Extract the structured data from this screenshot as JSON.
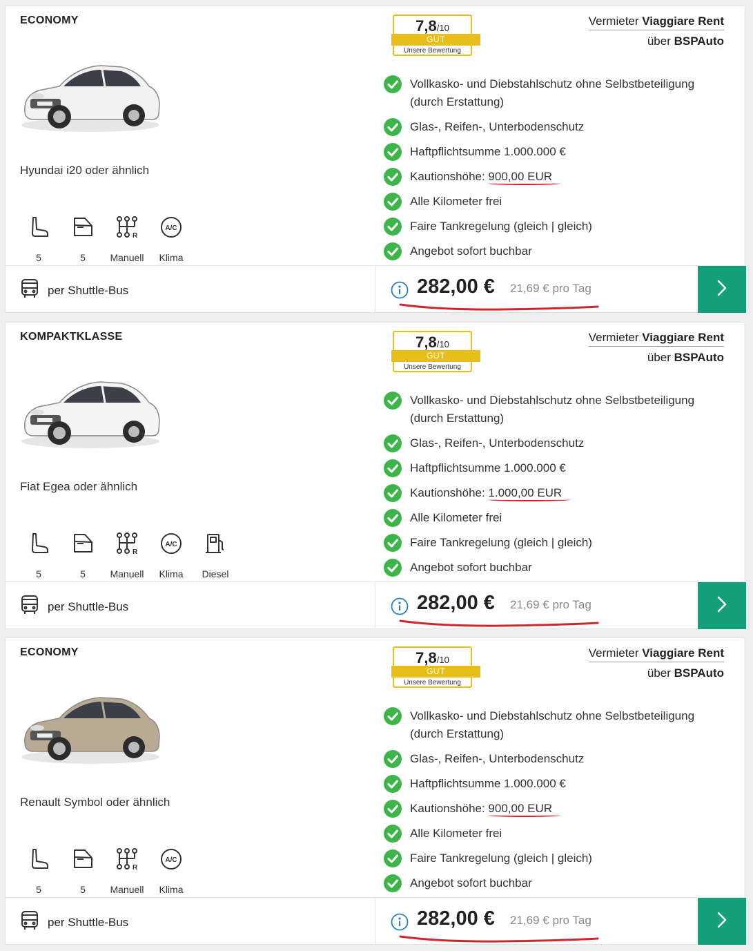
{
  "offers": [
    {
      "category": "ECONOMY",
      "car_name": "Hyundai i20 oder ähnlich",
      "car_color": "#f2f2f2",
      "features": [
        {
          "icon": "seat-icon",
          "label": "5"
        },
        {
          "icon": "door-icon",
          "label": "5"
        },
        {
          "icon": "gearbox-icon",
          "label": "Manuell"
        },
        {
          "icon": "ac-icon",
          "label": "Klima"
        }
      ],
      "rating": {
        "score": "7,8",
        "scale": "/10",
        "label": "GUT",
        "sub": "Unsere Bewertung"
      },
      "vendor": {
        "line1_prefix": "Vermieter ",
        "line1_name": "Viaggiare Rent",
        "line2_prefix": "über ",
        "line2_name": "BSPAuto"
      },
      "checklist": [
        "Vollkasko- und Diebstahlschutz ohne Selbstbeteiligung (durch Erstattung)",
        "Glas-, Reifen-, Unterbodenschutz",
        "Haftpflichtsumme 1.000.000 €",
        "Alle Kilometer frei",
        "Faire Tankregelung (gleich | gleich)",
        "Angebot sofort buchbar"
      ],
      "deposit_label": "Kautionshöhe: ",
      "deposit_value": "900,00 EUR",
      "transfer": "per Shuttle-Bus",
      "price": "282,00 €",
      "per_day": "21,69 € pro Tag"
    },
    {
      "category": "KOMPAKTKLASSE",
      "car_name": "Fiat Egea oder ähnlich",
      "car_color": "#f4f4f4",
      "features": [
        {
          "icon": "seat-icon",
          "label": "5"
        },
        {
          "icon": "door-icon",
          "label": "5"
        },
        {
          "icon": "gearbox-icon",
          "label": "Manuell"
        },
        {
          "icon": "ac-icon",
          "label": "Klima"
        },
        {
          "icon": "fuel-pump-icon",
          "label": "Diesel"
        }
      ],
      "rating": {
        "score": "7,8",
        "scale": "/10",
        "label": "GUT",
        "sub": "Unsere Bewertung"
      },
      "vendor": {
        "line1_prefix": "Vermieter ",
        "line1_name": "Viaggiare Rent",
        "line2_prefix": "über ",
        "line2_name": "BSPAuto"
      },
      "checklist": [
        "Vollkasko- und Diebstahlschutz ohne Selbstbeteiligung (durch Erstattung)",
        "Glas-, Reifen-, Unterbodenschutz",
        "Haftpflichtsumme 1.000.000 €",
        "Alle Kilometer frei",
        "Faire Tankregelung (gleich | gleich)",
        "Angebot sofort buchbar"
      ],
      "deposit_label": "Kautionshöhe: ",
      "deposit_value": "1.000,00 EUR",
      "transfer": "per Shuttle-Bus",
      "price": "282,00 €",
      "per_day": "21,69 € pro Tag"
    },
    {
      "category": "ECONOMY",
      "car_name": "Renault Symbol oder ähnlich",
      "car_color": "#b9ab93",
      "features": [
        {
          "icon": "seat-icon",
          "label": "5"
        },
        {
          "icon": "door-icon",
          "label": "5"
        },
        {
          "icon": "gearbox-icon",
          "label": "Manuell"
        },
        {
          "icon": "ac-icon",
          "label": "Klima"
        }
      ],
      "rating": {
        "score": "7,8",
        "scale": "/10",
        "label": "GUT",
        "sub": "Unsere Bewertung"
      },
      "vendor": {
        "line1_prefix": "Vermieter ",
        "line1_name": "Viaggiare Rent",
        "line2_prefix": "über ",
        "line2_name": "BSPAuto"
      },
      "checklist": [
        "Vollkasko- und Diebstahlschutz ohne Selbstbeteiligung (durch Erstattung)",
        "Glas-, Reifen-, Unterbodenschutz",
        "Haftpflichtsumme 1.000.000 €",
        "Alle Kilometer frei",
        "Faire Tankregelung (gleich | gleich)",
        "Angebot sofort buchbar"
      ],
      "deposit_label": "Kautionshöhe: ",
      "deposit_value": "900,00 EUR",
      "transfer": "per Shuttle-Bus",
      "price": "282,00 €",
      "per_day": "21,69 € pro Tag"
    }
  ],
  "colors": {
    "accent_green": "#13a07a",
    "check_green": "#3db54a",
    "rating_yellow": "#e8be1b",
    "annotation_red": "#d0262b"
  }
}
